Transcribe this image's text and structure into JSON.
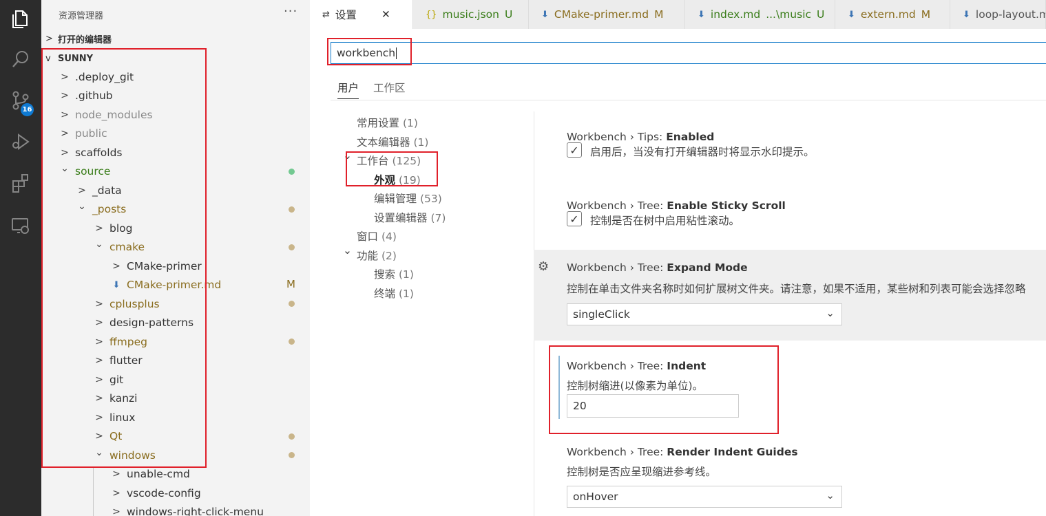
{
  "activity_bar": {
    "items": [
      {
        "name": "explorer",
        "icon": "files-icon"
      },
      {
        "name": "search",
        "icon": "search-icon"
      },
      {
        "name": "source-control",
        "icon": "source-control-icon",
        "badge": "16"
      },
      {
        "name": "run-debug",
        "icon": "run-debug-icon"
      },
      {
        "name": "extensions",
        "icon": "extensions-icon"
      },
      {
        "name": "remote-explorer",
        "icon": "remote-explorer-icon"
      }
    ]
  },
  "sidebar": {
    "title": "资源管理器",
    "more": "···",
    "open_editors": "打开的编辑器",
    "root": "SUNNY",
    "tree": [
      {
        "label": ".deploy_git",
        "depth": 1,
        "chevron": ">",
        "color": "def"
      },
      {
        "label": ".github",
        "depth": 1,
        "chevron": ">",
        "color": "def"
      },
      {
        "label": "node_modules",
        "depth": 1,
        "chevron": ">",
        "color": "dim"
      },
      {
        "label": "public",
        "depth": 1,
        "chevron": ">",
        "color": "dim"
      },
      {
        "label": "scaffolds",
        "depth": 1,
        "chevron": ">",
        "color": "def"
      },
      {
        "label": "source",
        "depth": 1,
        "chevron": "v",
        "color": "green",
        "dot": "#73c991"
      },
      {
        "label": "_data",
        "depth": 2,
        "chevron": ">",
        "color": "def"
      },
      {
        "label": "_posts",
        "depth": 2,
        "chevron": "v",
        "color": "brown",
        "dot": "#c9b58a"
      },
      {
        "label": "blog",
        "depth": 3,
        "chevron": ">",
        "color": "def"
      },
      {
        "label": "cmake",
        "depth": 3,
        "chevron": "v",
        "color": "brown",
        "dot": "#c9b58a"
      },
      {
        "label": "CMake-primer",
        "depth": 4,
        "chevron": ">",
        "color": "def"
      },
      {
        "label": "CMake-primer.md",
        "depth": 4,
        "chevron": "",
        "icon": "markdown-download-icon",
        "color": "brown",
        "flag": "M"
      },
      {
        "label": "cplusplus",
        "depth": 3,
        "chevron": ">",
        "color": "brown",
        "dot": "#c9b58a"
      },
      {
        "label": "design-patterns",
        "depth": 3,
        "chevron": ">",
        "color": "def"
      },
      {
        "label": "ffmpeg",
        "depth": 3,
        "chevron": ">",
        "color": "brown",
        "dot": "#c9b58a"
      },
      {
        "label": "flutter",
        "depth": 3,
        "chevron": ">",
        "color": "def"
      },
      {
        "label": "git",
        "depth": 3,
        "chevron": ">",
        "color": "def"
      },
      {
        "label": "kanzi",
        "depth": 3,
        "chevron": ">",
        "color": "def"
      },
      {
        "label": "linux",
        "depth": 3,
        "chevron": ">",
        "color": "def"
      },
      {
        "label": "Qt",
        "depth": 3,
        "chevron": ">",
        "color": "brown",
        "dot": "#c9b58a"
      },
      {
        "label": "windows",
        "depth": 3,
        "chevron": "v",
        "color": "brown",
        "dot": "#c9b58a"
      },
      {
        "label": "unable-cmd",
        "depth": 4,
        "chevron": ">",
        "color": "def"
      },
      {
        "label": "vscode-config",
        "depth": 4,
        "chevron": ">",
        "color": "def"
      },
      {
        "label": "windows-right-click-menu",
        "depth": 4,
        "chevron": ">",
        "color": "def"
      }
    ]
  },
  "tabs": [
    {
      "label": "设置",
      "icon": "settings-sliders-icon",
      "status": "",
      "active": true,
      "close": "✕",
      "color": "#333333"
    },
    {
      "label": "music.json",
      "icon": "json-braces-icon",
      "status": "U",
      "active": false,
      "color": "#3a7d1a"
    },
    {
      "label": "CMake-primer.md",
      "icon": "markdown-download-icon",
      "status": "M",
      "active": false,
      "color": "#8a6d1f"
    },
    {
      "label": "index.md",
      "icon": "markdown-download-icon",
      "extra": "...\\music",
      "status": "U",
      "active": false,
      "color": "#3a7d1a"
    },
    {
      "label": "extern.md",
      "icon": "markdown-download-icon",
      "status": "M",
      "active": false,
      "color": "#8a6d1f"
    },
    {
      "label": "loop-layout.m",
      "icon": "markdown-download-icon",
      "status": "",
      "active": false,
      "color": "#555555"
    }
  ],
  "settings": {
    "search_value": "workbench",
    "scope_tabs": [
      "用户",
      "工作区"
    ],
    "toc": [
      {
        "label": "常用设置",
        "count": "(1)"
      },
      {
        "label": "文本编辑器",
        "count": "(1)"
      },
      {
        "label": "工作台",
        "count": "(125)",
        "chevron": "v"
      },
      {
        "label": "外观",
        "count": "(19)",
        "bold": true
      },
      {
        "label": "编辑管理",
        "count": "(53)"
      },
      {
        "label": "设置编辑器",
        "count": "(7)"
      },
      {
        "label": "窗口",
        "count": "(4)"
      },
      {
        "label": "功能",
        "count": "(2)",
        "chevron": "v"
      },
      {
        "label": "搜索",
        "count": "(1)"
      },
      {
        "label": "终端",
        "count": "(1)"
      }
    ],
    "items": [
      {
        "prefix": "Workbench › Tips: ",
        "name": "Enabled",
        "kind": "checkbox",
        "checked": true,
        "desc": "启用后，当没有打开编辑器时将显示水印提示。"
      },
      {
        "prefix": "Workbench › Tree: ",
        "name": "Enable Sticky Scroll",
        "kind": "checkbox",
        "checked": true,
        "desc": "控制是否在树中启用粘性滚动。"
      },
      {
        "prefix": "Workbench › Tree: ",
        "name": "Expand Mode",
        "kind": "select",
        "desc": "控制在单击文件夹名称时如何扩展树文件夹。请注意，如果不适用，某些树和列表可能会选择忽略",
        "value": "singleClick",
        "gear": "gear-icon"
      },
      {
        "prefix": "Workbench › Tree: ",
        "name": "Indent",
        "kind": "number",
        "desc": "控制树缩进(以像素为单位)。",
        "value": "20",
        "modified": true
      },
      {
        "prefix": "Workbench › Tree: ",
        "name": "Render Indent Guides",
        "kind": "select",
        "desc": "控制树是否应呈现缩进参考线。",
        "value": "onHover"
      }
    ]
  },
  "colors": {
    "activity_bg": "#2c2c2c",
    "sidebar_bg": "#f3f3f3",
    "accent": "#0e78c8",
    "highlight_box": "#e0202a",
    "untracked_green": "#3a7d1a",
    "modified_brown": "#8a6d1f"
  }
}
